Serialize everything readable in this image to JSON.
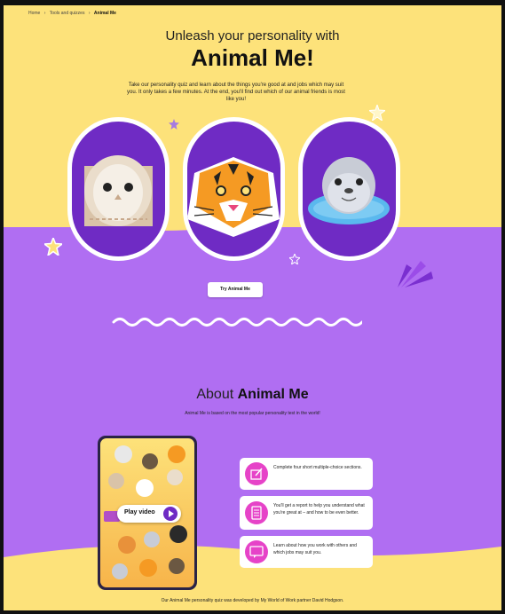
{
  "breadcrumb": {
    "items": [
      "Home",
      "Tools and quizzes",
      "Animal Me"
    ],
    "separator": "›"
  },
  "hero": {
    "subtitle": "Unleash your personality with",
    "title": "Animal Me!",
    "intro": "Take our personality quiz and learn about the things you're good at and jobs which may suit you. It only takes a few minutes. At the end, you'll find out which of our animal friends is most like you!",
    "animals": [
      {
        "icon": "owl-icon"
      },
      {
        "icon": "tiger-icon"
      },
      {
        "icon": "seal-icon"
      }
    ],
    "cta": "Try Animal Me"
  },
  "about": {
    "title_prefix": "About",
    "title_bold": "Animal Me",
    "subtitle": "Animal Me is based on the most popular personality test in the world!",
    "video_label": "Play video",
    "features": [
      {
        "icon": "pencil-icon",
        "text": "Complete four short multiple-choice sections."
      },
      {
        "icon": "report-icon",
        "text": "You'll get a report to help you understand what you're great at – and how to be even better."
      },
      {
        "icon": "chat-icon",
        "text": "Learn about how you work with others and which jobs may suit you."
      }
    ],
    "footer": "Our Animal Me personality quiz was developed by My World of Work partner David Hodgson."
  },
  "colors": {
    "yellow": "#fde27a",
    "purple": "#b06ef2",
    "deep_purple": "#6f2bc4",
    "pink": "#e643c8"
  }
}
